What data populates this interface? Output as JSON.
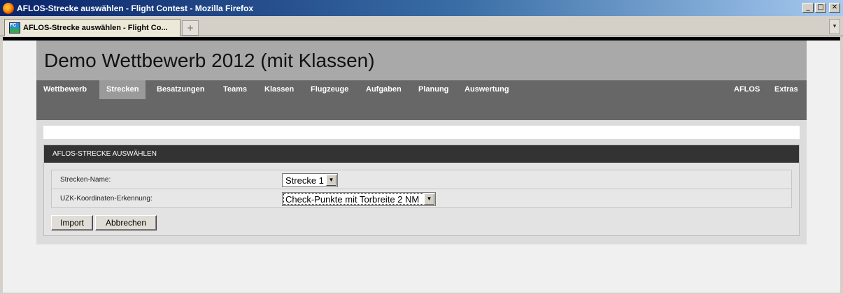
{
  "window": {
    "title": "AFLOS-Strecke auswählen - Flight Contest - Mozilla Firefox",
    "minimize": "_",
    "maximize": "□",
    "close": "✕"
  },
  "browser": {
    "tab_title": "AFLOS-Strecke auswählen - Flight Co...",
    "tab_icon_text": "FC",
    "new_tab_symbol": "+",
    "tab_list_symbol": "▾"
  },
  "page": {
    "contest_title": "Demo Wettbewerb 2012 (mit Klassen)",
    "nav_left": [
      "Wettbewerb",
      "Strecken",
      "Besatzungen",
      "Teams",
      "Klassen",
      "Flugzeuge",
      "Aufgaben",
      "Planung",
      "Auswertung"
    ],
    "nav_right": [
      "AFLOS",
      "Extras"
    ],
    "active_nav": "Strecken"
  },
  "form": {
    "heading": "AFLOS-STRECKE AUSWÄHLEN",
    "route_name_label": "Strecken-Name:",
    "route_name_value": "Strecke 1",
    "coord_label": "UZK-Koordinaten-Erkennung:",
    "coord_value": "Check-Punkte mit Torbreite 2 NM",
    "import_button": "Import",
    "cancel_button": "Abbrechen"
  }
}
